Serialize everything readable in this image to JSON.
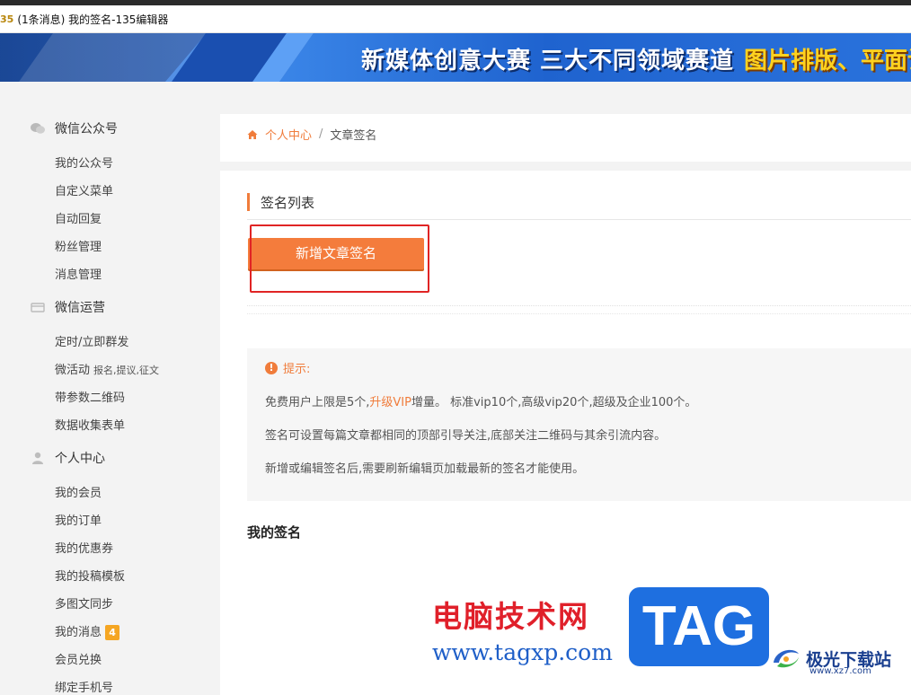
{
  "window": {
    "title": "(1条消息) 我的签名-135编辑器",
    "logo_text": "35"
  },
  "banner": {
    "headline": "新媒体创意大赛 三大不同领域赛道",
    "sub": "图片排版、平面设"
  },
  "sidebar": {
    "groups": [
      {
        "title": "微信公众号",
        "icon": "wechat-icon",
        "items": [
          "我的公众号",
          "自定义菜单",
          "自动回复",
          "粉丝管理",
          "消息管理"
        ]
      },
      {
        "title": "微信运营",
        "icon": "card-icon",
        "items": [
          "定时/立即群发",
          "微活动",
          "带参数二维码",
          "数据收集表单"
        ],
        "micro_activity_note": "报名,提议,征文"
      },
      {
        "title": "个人中心",
        "icon": "user-icon",
        "items": [
          "我的会员",
          "我的订单",
          "我的优惠券",
          "我的投稿模板",
          "多图文同步",
          "我的消息",
          "会员兑换",
          "绑定手机号"
        ],
        "message_badge": "4"
      }
    ]
  },
  "breadcrumb": {
    "home": "个人中心",
    "separator": "/",
    "current": "文章签名"
  },
  "main": {
    "section_title": "签名列表",
    "add_button": "新增文章签名",
    "tips": {
      "title": "提示:",
      "line1_prefix": "免费用户上限是5个,",
      "line1_link": "升级VIP",
      "line1_suffix": "增量。 标准vip10个,高级vip20个,超级及企业100个。",
      "line2": "签名可设置每篇文章都相同的顶部引导关注,底部关注二维码与其余引流内容。",
      "line3": "新增或编辑签名后,需要刷新编辑页加载最新的签名才能使用。"
    },
    "my_signatures": "我的签名"
  },
  "watermark": {
    "cn": "电脑技术网",
    "url": "www.tagxp.com",
    "tag": "TAG",
    "brand": "极光下载站",
    "brand_url": "www.xz7.com"
  },
  "colors": {
    "accent": "#f07c3b",
    "highlight_frame": "#e02424",
    "badge": "#f5a623"
  }
}
